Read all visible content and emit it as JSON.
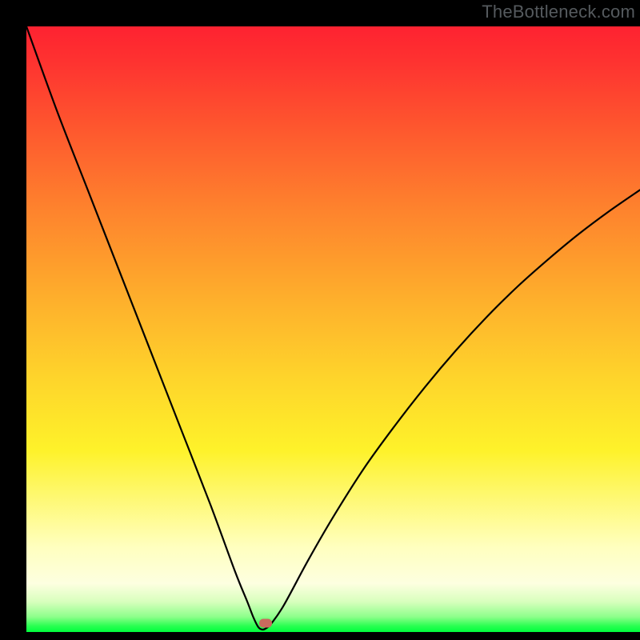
{
  "watermark": {
    "text": "TheBottleneck.com"
  },
  "chart_data": {
    "type": "line",
    "title": "",
    "xlabel": "",
    "ylabel": "",
    "xlim": [
      0,
      100
    ],
    "ylim": [
      0,
      100
    ],
    "grid": false,
    "legend": false,
    "series": [
      {
        "name": "curve",
        "x": [
          0,
          5,
          10,
          15,
          20,
          25,
          30,
          34,
          36,
          37,
          37.8,
          38.5,
          39.2,
          40,
          42,
          46,
          50,
          55,
          60,
          65,
          70,
          75,
          80,
          85,
          90,
          95,
          100
        ],
        "y": [
          100,
          86,
          73,
          60,
          47,
          34,
          21,
          10,
          5,
          2.4,
          0.8,
          0.4,
          0.7,
          1.5,
          4.5,
          12,
          19,
          27,
          34,
          40.5,
          46.5,
          52,
          57,
          61.5,
          65.7,
          69.5,
          73
        ]
      }
    ],
    "marker": {
      "x": 39.0,
      "y": 1.4
    },
    "background_gradient": {
      "direction": "vertical",
      "stops": [
        {
          "pos": 0,
          "color": "#fe2231"
        },
        {
          "pos": 0.3,
          "color": "#fe822d"
        },
        {
          "pos": 0.58,
          "color": "#fed42b"
        },
        {
          "pos": 0.86,
          "color": "#ffffbf"
        },
        {
          "pos": 0.95,
          "color": "#d8ffbd"
        },
        {
          "pos": 1.0,
          "color": "#00ff3d"
        }
      ]
    }
  }
}
